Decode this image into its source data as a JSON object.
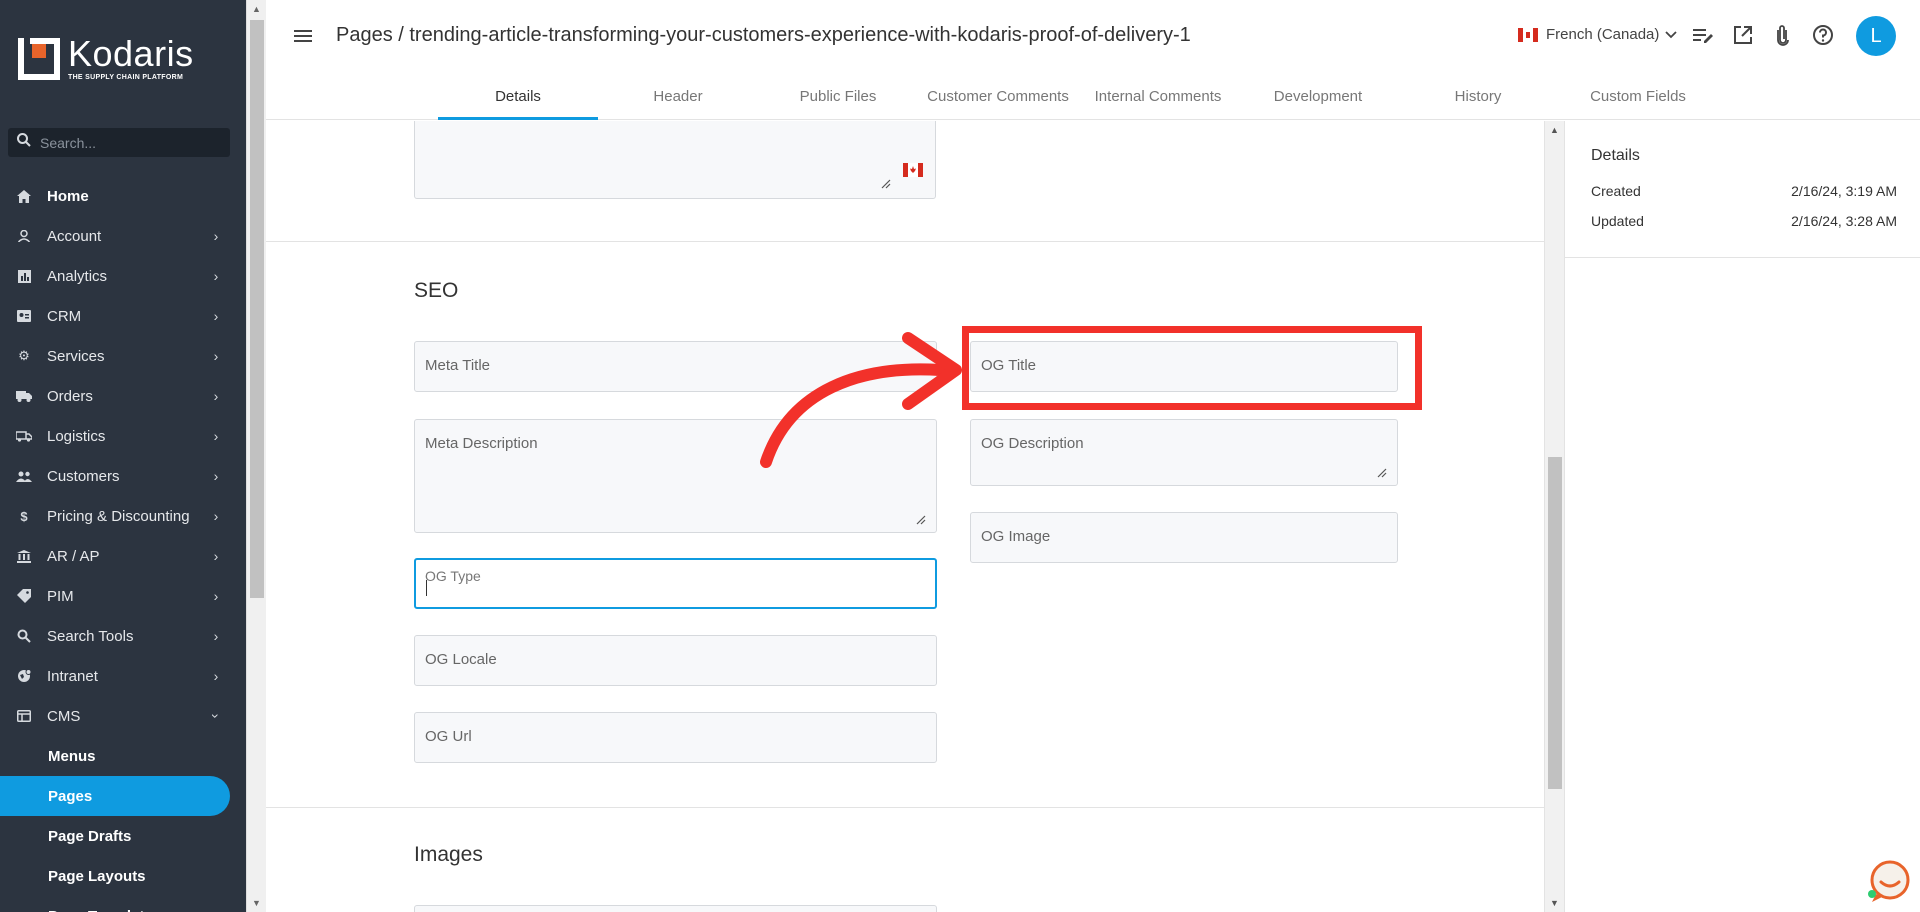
{
  "sidebar": {
    "brand": "Kodaris",
    "tagline": "THE SUPPLY CHAIN PLATFORM",
    "search_placeholder": "Search...",
    "items": [
      {
        "label": "Home",
        "icon": "home-icon"
      },
      {
        "label": "Account",
        "icon": "account-icon"
      },
      {
        "label": "Analytics",
        "icon": "analytics-icon"
      },
      {
        "label": "CRM",
        "icon": "crm-icon"
      },
      {
        "label": "Services",
        "icon": "services-icon"
      },
      {
        "label": "Orders",
        "icon": "orders-icon"
      },
      {
        "label": "Logistics",
        "icon": "logistics-icon"
      },
      {
        "label": "Customers",
        "icon": "customers-icon"
      },
      {
        "label": "Pricing & Discounting",
        "icon": "dollar-icon"
      },
      {
        "label": "AR / AP",
        "icon": "bank-icon"
      },
      {
        "label": "PIM",
        "icon": "tag-icon"
      },
      {
        "label": "Search Tools",
        "icon": "search-tools-icon"
      },
      {
        "label": "Intranet",
        "icon": "intranet-icon"
      },
      {
        "label": "CMS",
        "icon": "cms-icon"
      }
    ],
    "cms_children": [
      "Menus",
      "Pages",
      "Page Drafts",
      "Page Layouts",
      "Page Templates"
    ],
    "active_child": "Pages"
  },
  "header": {
    "title": "Pages / trending-article-transforming-your-customers-experience-with-kodaris-proof-of-delivery-1",
    "language": "French (Canada)",
    "avatar_letter": "L",
    "tabs": [
      "Details",
      "Header",
      "Public Files",
      "Customer Comments",
      "Internal Comments",
      "Development",
      "History",
      "Custom Fields"
    ],
    "active_tab": "Details"
  },
  "seo": {
    "title": "SEO",
    "meta_title": "Meta Title",
    "meta_description": "Meta Description",
    "og_type": "OG Type",
    "og_locale": "OG Locale",
    "og_url": "OG Url",
    "og_title": "OG Title",
    "og_description": "OG Description",
    "og_image": "OG Image"
  },
  "images_section": {
    "title": "Images"
  },
  "details_panel": {
    "heading": "Details",
    "created_label": "Created",
    "created_value": "2/16/24, 3:19 AM",
    "updated_label": "Updated",
    "updated_value": "2/16/24, 3:28 AM"
  },
  "colors": {
    "sidebar_bg": "#2c3440",
    "accent": "#0f9be0",
    "annotation_red": "#f2312a"
  }
}
